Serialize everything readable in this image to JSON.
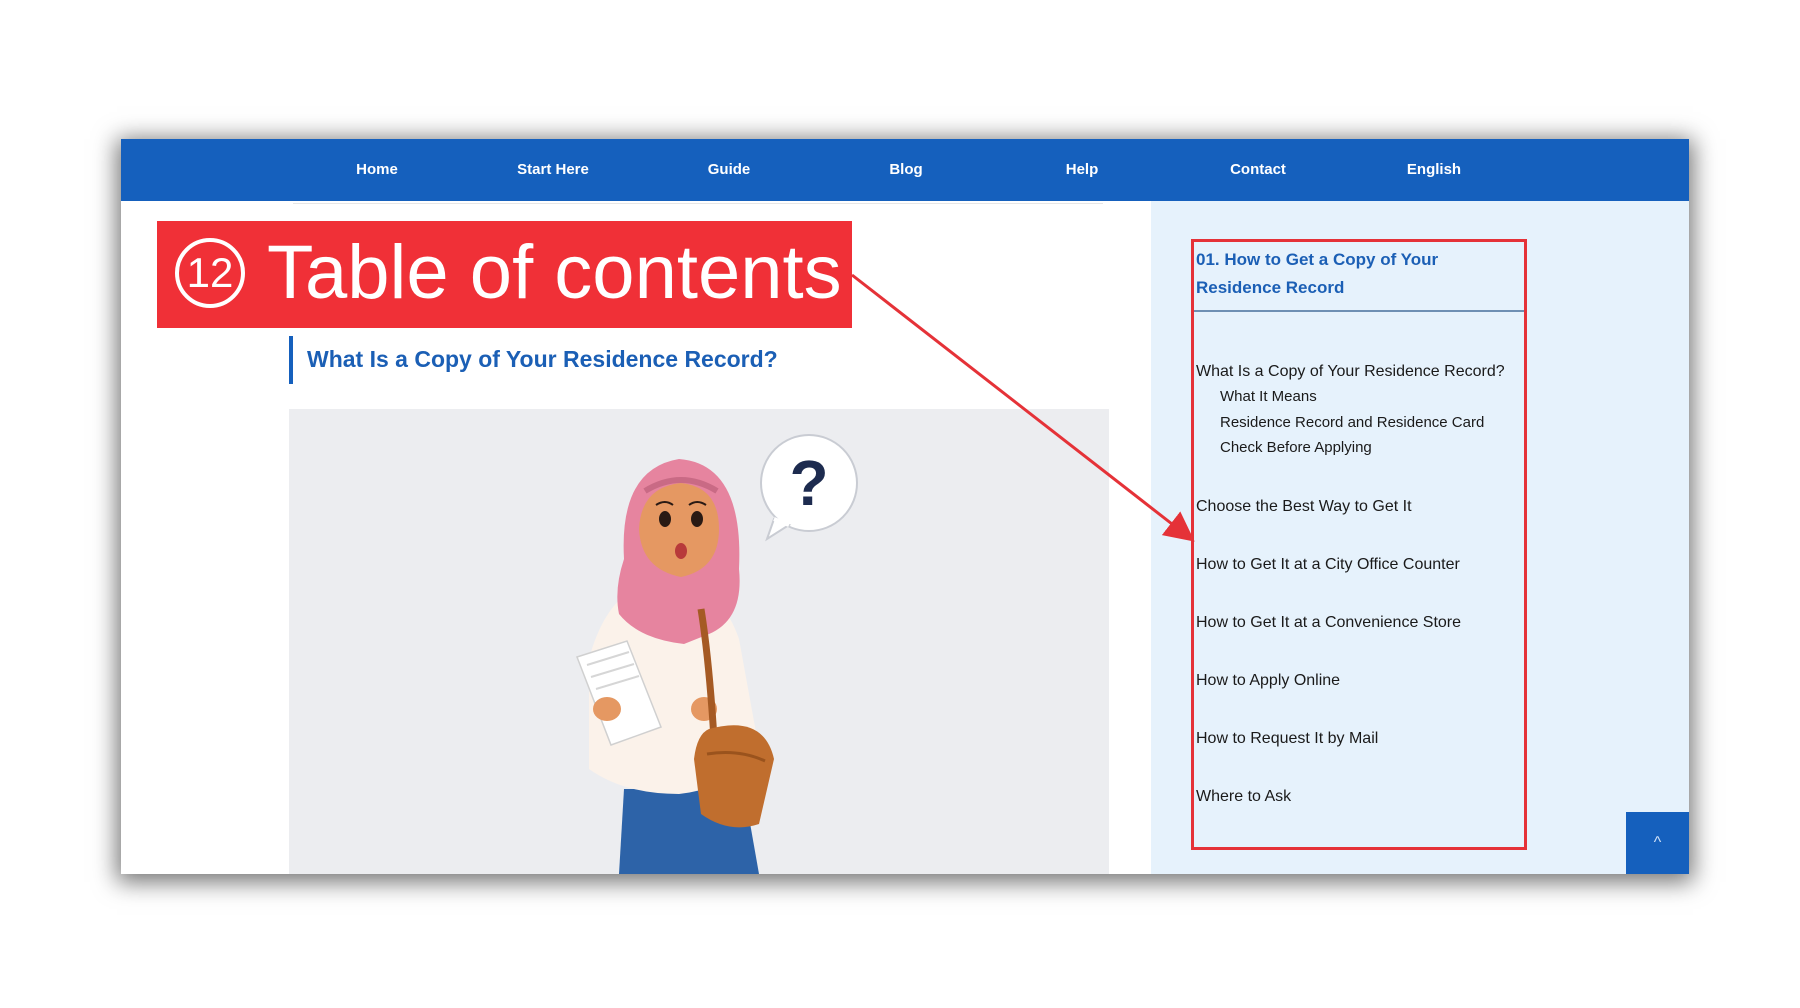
{
  "nav": {
    "items": [
      "Home",
      "Start Here",
      "Guide",
      "Blog",
      "Help",
      "Contact",
      "English"
    ]
  },
  "main": {
    "section_heading": "What Is a Copy of Your Residence Record?",
    "illustration": "question-mark"
  },
  "toc": {
    "title": "01. How to Get a Copy of Your Residence Record",
    "items": [
      {
        "label": "What Is a Copy of Your Residence Record?"
      },
      {
        "label": "What It Means"
      },
      {
        "label": "Residence Record and Residence Card"
      },
      {
        "label": "Check Before Applying"
      },
      {
        "label": "Choose the Best Way to Get It"
      },
      {
        "label": "How to Get It at a City Office Counter"
      },
      {
        "label": "How to Get It at a Convenience Store"
      },
      {
        "label": "How to Apply Online"
      },
      {
        "label": "How to Request It by Mail"
      },
      {
        "label": "Where to Ask"
      }
    ]
  },
  "back_to_top": {
    "icon": "chevron-up-icon",
    "glyph": "^"
  },
  "annotation": {
    "number": "12",
    "label": "Table of contents",
    "color": "#f03037"
  },
  "colors": {
    "nav_bg": "#1560bd",
    "accent_text": "#1b5fb5",
    "sidebar_bg": "#e6f2fc",
    "highlight_border": "#e53238"
  }
}
